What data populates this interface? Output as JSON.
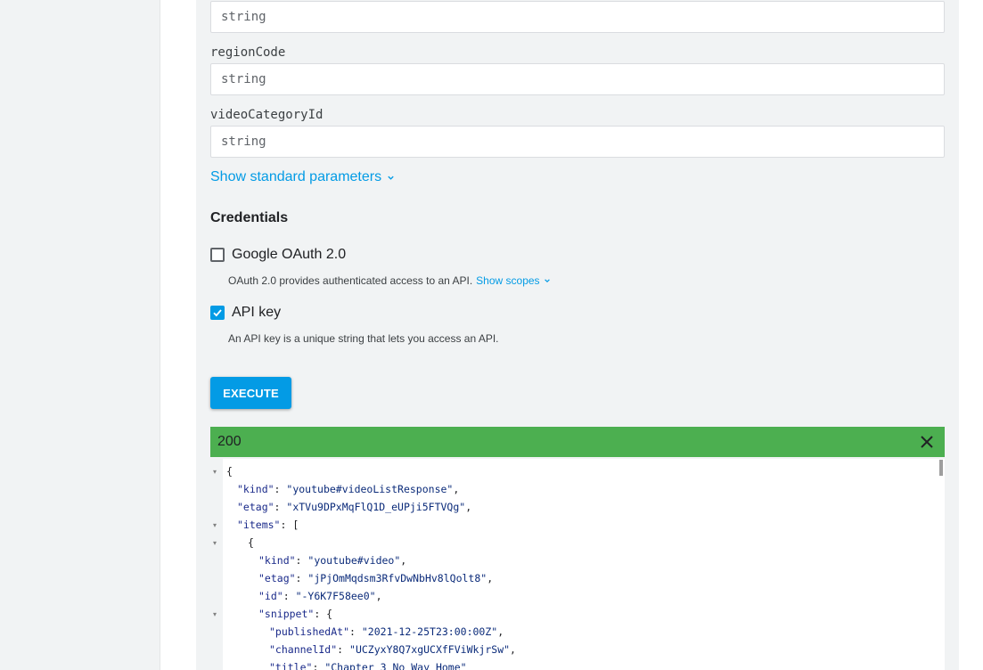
{
  "params": [
    {
      "label": "",
      "placeholder": "string"
    },
    {
      "label": "regionCode",
      "placeholder": "string"
    },
    {
      "label": "videoCategoryId",
      "placeholder": "string"
    }
  ],
  "show_standard_parameters": "Show standard parameters",
  "credentials": {
    "title": "Credentials",
    "oauth": {
      "label": "Google OAuth 2.0",
      "checked": false,
      "description": "OAuth 2.0 provides authenticated access to an API.",
      "show_scopes": "Show scopes"
    },
    "apikey": {
      "label": "API key",
      "checked": true,
      "description": "An API key is a unique string that lets you access an API."
    }
  },
  "execute_label": "EXECUTE",
  "response": {
    "status": "200",
    "status_color": "#4caf50",
    "lines": {
      "l0": "{",
      "l1_key": "\"kind\"",
      "l1_val": "\"youtube#videoListResponse\"",
      "l2_key": "\"etag\"",
      "l2_val": "\"xTVu9DPxMqFlQ1D_eUPji5FTVQg\"",
      "l3_key": "\"items\"",
      "l3_val": "[",
      "l4": "{",
      "l5_key": "\"kind\"",
      "l5_val": "\"youtube#video\"",
      "l6_key": "\"etag\"",
      "l6_val": "\"jPjOmMqdsm3RfvDwNbHv8lQolt8\"",
      "l7_key": "\"id\"",
      "l7_val": "\"-Y6K7F58ee0\"",
      "l8_key": "\"snippet\"",
      "l8_val": "{",
      "l9_key": "\"publishedAt\"",
      "l9_val": "\"2021-12-25T23:00:00Z\"",
      "l10_key": "\"channelId\"",
      "l10_val": "\"UCZyxY8Q7xgUCXfFViWkjrSw\"",
      "l11_key": "\"title\"",
      "l11_val": "\"Chapter 3 No Way Home\""
    }
  },
  "colors": {
    "accent": "#039be5",
    "success": "#4caf50"
  }
}
